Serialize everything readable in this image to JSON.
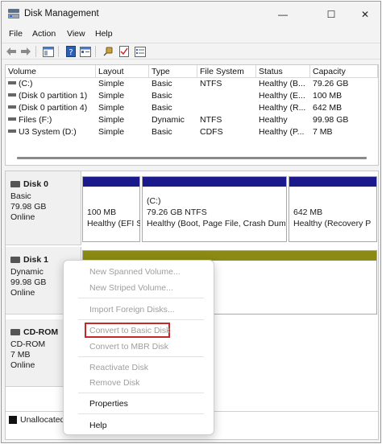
{
  "window": {
    "title": "Disk Management",
    "minimize": "—",
    "maximize": "☐",
    "close": "✕"
  },
  "menu": [
    "File",
    "Action",
    "View",
    "Help"
  ],
  "volume_table": {
    "columns": [
      "Volume",
      "Layout",
      "Type",
      "File System",
      "Status",
      "Capacity"
    ],
    "rows": [
      {
        "volume": "(C:)",
        "layout": "Simple",
        "type": "Basic",
        "fs": "NTFS",
        "status": "Healthy (B...",
        "capacity": "79.26 GB"
      },
      {
        "volume": "(Disk 0 partition 1)",
        "layout": "Simple",
        "type": "Basic",
        "fs": "",
        "status": "Healthy (E...",
        "capacity": "100 MB"
      },
      {
        "volume": "(Disk 0 partition 4)",
        "layout": "Simple",
        "type": "Basic",
        "fs": "",
        "status": "Healthy (R...",
        "capacity": "642 MB"
      },
      {
        "volume": "Files (F:)",
        "layout": "Simple",
        "type": "Dynamic",
        "fs": "NTFS",
        "status": "Healthy",
        "capacity": "99.98 GB"
      },
      {
        "volume": "U3 System (D:)",
        "layout": "Simple",
        "type": "Basic",
        "fs": "CDFS",
        "status": "Healthy (P...",
        "capacity": "7 MB"
      }
    ]
  },
  "disks": [
    {
      "name": "Disk 0",
      "lines": [
        "Basic",
        "79.98 GB",
        "Online"
      ]
    },
    {
      "name": "Disk 1",
      "lines": [
        "Dynamic",
        "99.98 GB",
        "Online"
      ]
    },
    {
      "name": "CD-ROM",
      "lines": [
        "CD-ROM",
        "7 MB",
        "Online"
      ]
    }
  ],
  "disk0_partitions": [
    {
      "title": "",
      "size": "100 MB",
      "status": "Healthy (EFI S"
    },
    {
      "title": "(C:)",
      "size": "79.26 GB NTFS",
      "status": "Healthy (Boot, Page File, Crash Dump"
    },
    {
      "title": "",
      "size": "642 MB",
      "status": "Healthy (Recovery P"
    }
  ],
  "legend": {
    "unallocated": "Unallocated"
  },
  "colors": {
    "primary_partition": "#1a1a8c",
    "dynamic_volume": "#8a8a14",
    "highlight": "#c62828"
  },
  "context_menu": {
    "items": [
      {
        "label": "New Spanned Volume...",
        "enabled": false
      },
      {
        "label": "New Striped Volume...",
        "enabled": false
      },
      {
        "label": "Import Foreign Disks...",
        "enabled": false
      },
      {
        "label": "Convert to Basic Disk",
        "enabled": false,
        "highlighted": true
      },
      {
        "label": "Convert to MBR Disk",
        "enabled": false
      },
      {
        "label": "Reactivate Disk",
        "enabled": false
      },
      {
        "label": "Remove Disk",
        "enabled": false
      },
      {
        "label": "Properties",
        "enabled": true
      },
      {
        "label": "Help",
        "enabled": true
      }
    ]
  }
}
